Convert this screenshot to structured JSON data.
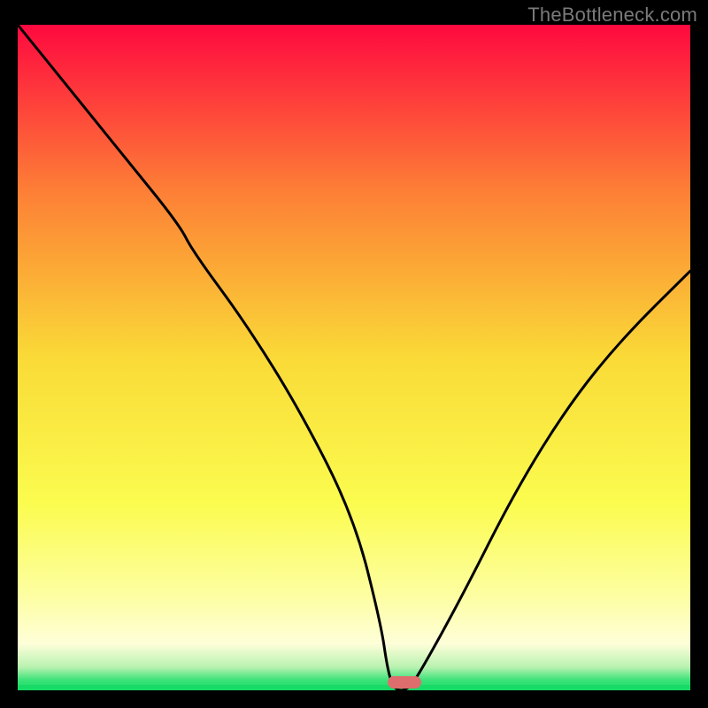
{
  "watermark": "TheBottleneck.com",
  "colors": {
    "frame": "#000000",
    "watermark": "#7a7a7a",
    "curve": "#000000",
    "marker_fill": "#de6e6d",
    "gradient_stops": [
      {
        "offset": 0.0,
        "color": "#fe093f"
      },
      {
        "offset": 0.25,
        "color": "#fd7f36"
      },
      {
        "offset": 0.5,
        "color": "#fada37"
      },
      {
        "offset": 0.72,
        "color": "#fbfc4f"
      },
      {
        "offset": 0.86,
        "color": "#fdfea3"
      },
      {
        "offset": 0.93,
        "color": "#fefed9"
      },
      {
        "offset": 0.965,
        "color": "#b9f2b1"
      },
      {
        "offset": 0.985,
        "color": "#3ae278"
      },
      {
        "offset": 1.0,
        "color": "#16db66"
      }
    ]
  },
  "chart_data": {
    "type": "line",
    "title": "",
    "xlabel": "",
    "ylabel": "",
    "xlim": [
      0,
      100
    ],
    "ylim": [
      0,
      100
    ],
    "x": [
      0,
      8,
      16,
      24,
      26,
      34,
      42,
      50,
      54,
      55,
      56,
      58,
      60,
      66,
      74,
      82,
      90,
      100
    ],
    "values": [
      100,
      90,
      80,
      70,
      66,
      55,
      42,
      26,
      10,
      3,
      0,
      0,
      3,
      14,
      30,
      43,
      53,
      63
    ],
    "optimum_x_range": [
      55,
      60
    ],
    "notes": "Black V-shaped curve over vertical red→yellow→green gradient; pill marker at the bottom near x≈57."
  }
}
